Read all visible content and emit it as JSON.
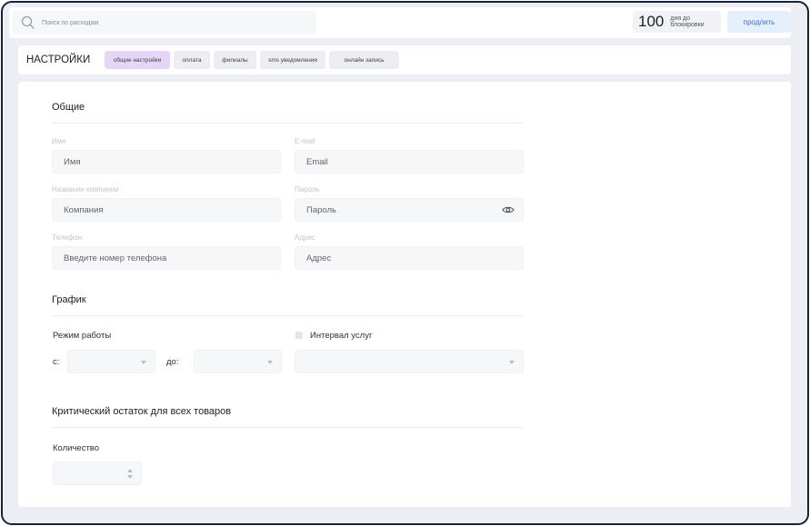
{
  "topbar": {
    "search_placeholder": "Поиск по расходам",
    "days_number": "100",
    "days_label": "дня до блокировки",
    "renew_label": "продлить"
  },
  "settings": {
    "title": "НАСТРОЙКИ",
    "tabs": [
      {
        "label": "общие настройки",
        "active": true
      },
      {
        "label": "оплата",
        "active": false
      },
      {
        "label": "филиалы",
        "active": false
      },
      {
        "label": "sms уведомления",
        "active": false
      },
      {
        "label": "онлайн запись",
        "active": false
      }
    ]
  },
  "general": {
    "title": "Общие",
    "fields": {
      "name": {
        "label": "Имя",
        "placeholder": "Имя"
      },
      "email": {
        "label": "E-mail",
        "placeholder": "Email"
      },
      "company": {
        "label": "Название компании",
        "placeholder": "Компания"
      },
      "password": {
        "label": "Пароль",
        "placeholder": "Пароль"
      },
      "phone": {
        "label": "Телефон",
        "placeholder": "Введите номер телефона"
      },
      "address": {
        "label": "Адрес",
        "placeholder": "Адрес"
      }
    }
  },
  "schedule": {
    "title": "График",
    "mode_label": "Режим работы",
    "from_label": "с:",
    "to_label": "до:",
    "interval_label": "Интервал услуг"
  },
  "stock": {
    "title": "Критический остаток  для всех товаров",
    "quantity_label": "Количество"
  },
  "colors": {
    "frame": "#15233a",
    "active_tab": "#e5d6f7",
    "renew_bg": "#e6effc",
    "renew_text": "#3d6fd0"
  }
}
